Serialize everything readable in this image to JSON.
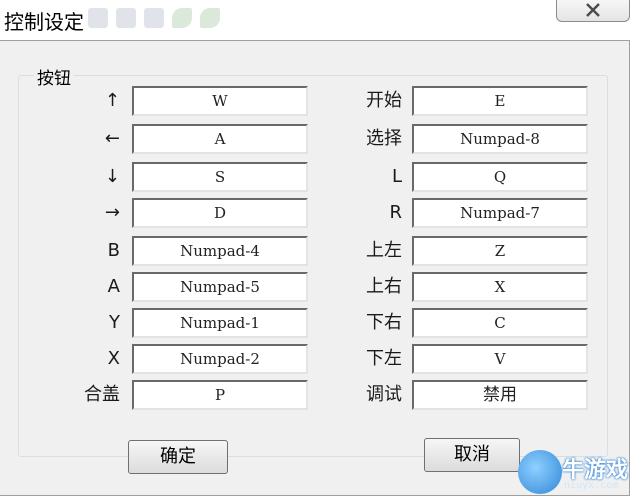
{
  "window": {
    "title": "控制设定"
  },
  "group": {
    "title": "按钮"
  },
  "left_rows": [
    {
      "label": "↑",
      "value": "W"
    },
    {
      "label": "←",
      "value": "A"
    },
    {
      "label": "↓",
      "value": "S"
    },
    {
      "label": "→",
      "value": "D"
    },
    {
      "label": "B",
      "value": "Numpad-4"
    },
    {
      "label": "A",
      "value": "Numpad-5"
    },
    {
      "label": "Y",
      "value": "Numpad-1"
    },
    {
      "label": "X",
      "value": "Numpad-2"
    },
    {
      "label": "合盖",
      "value": "P"
    }
  ],
  "right_rows": [
    {
      "label": "开始",
      "value": "E"
    },
    {
      "label": "选择",
      "value": "Numpad-8"
    },
    {
      "label": "L",
      "value": "Q"
    },
    {
      "label": "R",
      "value": "Numpad-7"
    },
    {
      "label": "上左",
      "value": "Z"
    },
    {
      "label": "上右",
      "value": "X"
    },
    {
      "label": "下右",
      "value": "C"
    },
    {
      "label": "下左",
      "value": "V"
    },
    {
      "label": "调试",
      "value": "禁用"
    }
  ],
  "buttons": {
    "ok": "确定",
    "cancel": "取消"
  },
  "watermark": {
    "text": "牛游戏",
    "sub": "niuyx.com"
  },
  "colors": {
    "dialog_bg": "#f0f0f0",
    "field_bg": "#ffffff",
    "watermark_blue": "#2f86d8"
  }
}
